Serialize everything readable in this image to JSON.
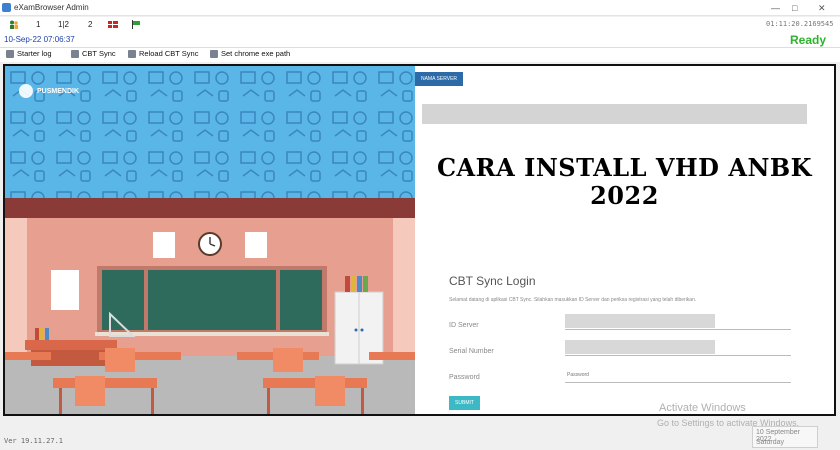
{
  "window": {
    "title": "eXamBrowser Admin",
    "controls": {
      "minimize": "—",
      "maximize": "□",
      "close": "✕"
    }
  },
  "toolbar": {
    "counts": [
      "1",
      "1|2",
      "2"
    ],
    "ip_address": "01:11:20.2169545"
  },
  "status": {
    "datetime": "10-Sep-22 07:06:37",
    "state": "Ready",
    "state_color": "#2bb52b"
  },
  "menu": {
    "items": [
      {
        "label": "Starter log",
        "icon": "log-icon"
      },
      {
        "label": "CBT Sync",
        "icon": "sync-icon"
      },
      {
        "label": "Reload CBT Sync",
        "icon": "reload-icon"
      },
      {
        "label": "Set chrome exe path",
        "icon": "settings-icon"
      }
    ]
  },
  "illustration": {
    "logo_text": "PUSMENDIK"
  },
  "panel": {
    "server_tag": "NAMA SERVER",
    "headline_line1": "CARA INSTALL VHD ANBK",
    "headline_line2": "2022",
    "login_title": "CBT Sync Login",
    "login_subtitle": "Selamat datang di aplikasi CBT Sync. Silahkan masukkan ID Server dan periksa registrasi yang telah diberikan.",
    "fields": {
      "id_server_label": "ID Server",
      "serial_number_label": "Serial Number",
      "password_label": "Password",
      "password_placeholder": "Password"
    },
    "submit_label": "SUBMIT"
  },
  "watermark": {
    "line1": "Activate Windows",
    "line2": "Go to Settings to activate Windows."
  },
  "footer": {
    "version": "Ver 19.11.27.1",
    "clock_date": "10 September 2022",
    "clock_day": "Saturday"
  },
  "colors": {
    "sky_blue": "#5bb6e8",
    "wall": "#e7a08f",
    "board": "#2f6b5c",
    "accent_blue": "#2c6aa8",
    "submit": "#3db8c5"
  }
}
